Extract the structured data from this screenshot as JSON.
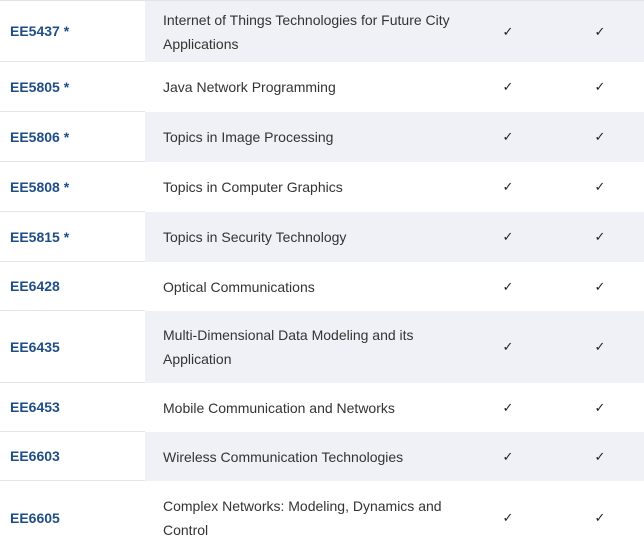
{
  "check_symbol": "✓",
  "rows": [
    {
      "code": "EE5437 *",
      "title": "Internet of Things Technologies for Future City Applications"
    },
    {
      "code": "EE5805 *",
      "title": "Java Network Programming"
    },
    {
      "code": "EE5806 *",
      "title": "Topics in Image Processing"
    },
    {
      "code": "EE5808 *",
      "title": "Topics in Computer Graphics"
    },
    {
      "code": "EE5815 *",
      "title": "Topics in Security Technology"
    },
    {
      "code": "EE6428",
      "title": "Optical Communications"
    },
    {
      "code": "EE6435",
      "title": "Multi-Dimensional Data Modeling and its Application"
    },
    {
      "code": "EE6453",
      "title": "Mobile Communication and Networks"
    },
    {
      "code": "EE6603",
      "title": "Wireless Communication Technologies"
    },
    {
      "code": "EE6605",
      "title": "Complex Networks: Modeling, Dynamics and Control"
    }
  ]
}
